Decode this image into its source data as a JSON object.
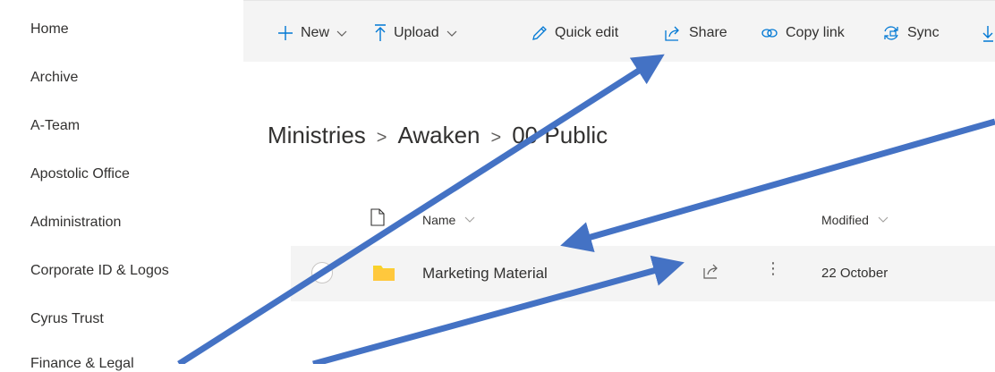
{
  "nav": {
    "items": [
      "Home",
      "Archive",
      "A-Team",
      "Apostolic Office",
      "Administration",
      "Corporate ID & Logos",
      "Cyrus Trust",
      "Finance & Legal"
    ]
  },
  "toolbar": {
    "new_label": "New",
    "upload_label": "Upload",
    "quick_edit_label": "Quick edit",
    "share_label": "Share",
    "copy_link_label": "Copy link",
    "sync_label": "Sync"
  },
  "breadcrumb": [
    "Ministries",
    "Awaken",
    "00 Public"
  ],
  "list": {
    "columns": {
      "name": "Name",
      "modified": "Modified"
    },
    "rows": [
      {
        "name": "Marketing Material",
        "modified": "22 October",
        "type": "folder"
      }
    ]
  },
  "colors": {
    "accent": "#0078d4",
    "arrow": "#4472c4",
    "folder": "#f8d22a",
    "commandbar": "#f4f4f4"
  },
  "icons": [
    "add-icon",
    "chevron-down-icon",
    "upload-icon",
    "pencil-icon",
    "share-icon",
    "link-icon",
    "sync-icon",
    "download-icon",
    "document-icon",
    "folder-icon",
    "more-icon"
  ]
}
